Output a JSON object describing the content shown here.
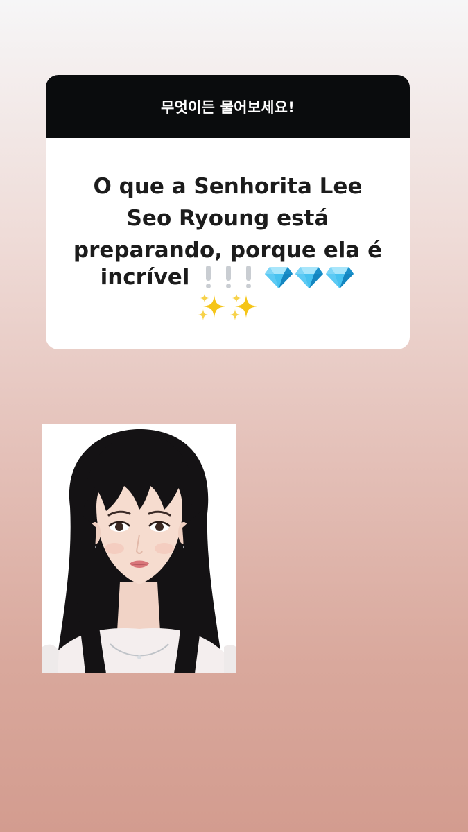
{
  "question_card": {
    "header": "무엇이든 물어보세요!",
    "question_lines": [
      "O que a Senhorita Lee",
      "Seo Ryoung está",
      "preparando, porque ela é"
    ],
    "last_word": "incrível",
    "emojis": {
      "exclamations": [
        "white-exclamation-icon",
        "white-exclamation-icon",
        "white-exclamation-icon"
      ],
      "gems": [
        "gem-stone-icon",
        "gem-stone-icon",
        "gem-stone-icon"
      ],
      "sparkles": [
        "sparkles-icon",
        "sparkles-icon"
      ]
    }
  },
  "photo": {
    "alt": "portrait-photo"
  },
  "colors": {
    "header_bg": "#0a0c0d",
    "card_bg": "#ffffff",
    "gem": "#2ab4ec",
    "sparkle": "#f5c518"
  }
}
